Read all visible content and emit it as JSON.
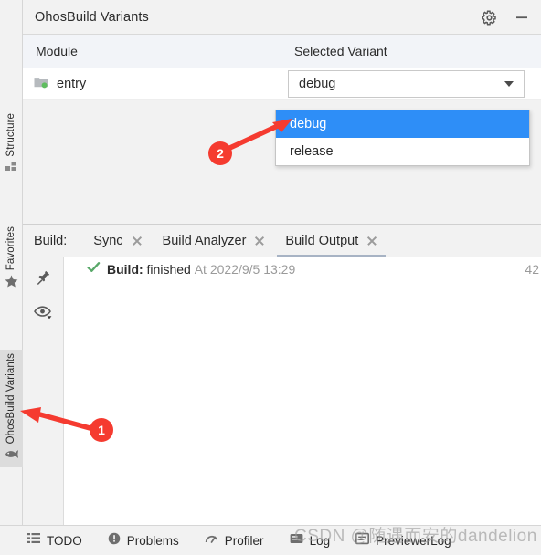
{
  "panel": {
    "title": "OhosBuild Variants",
    "actions": [
      {
        "name": "settings-icon",
        "label": "Settings"
      },
      {
        "name": "minimize-icon",
        "label": "Hide"
      }
    ],
    "columns": [
      "Module",
      "Selected Variant"
    ],
    "rows": [
      {
        "module": "entry",
        "variant": "debug"
      }
    ],
    "dropdown": {
      "open": true,
      "options": [
        "debug",
        "release"
      ],
      "selected": "debug"
    }
  },
  "left_rail": {
    "top_items": [
      {
        "label": "Structure",
        "icon": "structure-icon",
        "active": false
      },
      {
        "label": "Favorites",
        "icon": "star-icon",
        "active": false
      }
    ],
    "bottom_items": [
      {
        "label": "OhosBuild Variants",
        "icon": "fish-icon",
        "active": true
      }
    ]
  },
  "build_window": {
    "prefix": "Build:",
    "tabs": [
      {
        "label": "Sync",
        "active": false,
        "closable": true
      },
      {
        "label": "Build Analyzer",
        "active": false,
        "closable": true
      },
      {
        "label": "Build Output",
        "active": true,
        "closable": true
      }
    ],
    "gutter_buttons": [
      {
        "name": "pin-icon",
        "label": "Pin Tab"
      },
      {
        "name": "eye-icon",
        "label": "Show Options"
      }
    ],
    "output_row": {
      "status_icon": "check-icon",
      "prefix": "Build:",
      "result": "finished",
      "timestamp": "At 2022/9/5 13:29",
      "duration": "42"
    }
  },
  "status_bar": {
    "items": [
      {
        "label": "TODO",
        "icon": "list-icon"
      },
      {
        "label": "Problems",
        "icon": "warning-icon"
      },
      {
        "label": "Profiler",
        "icon": "gauge-icon"
      },
      {
        "label": "Log",
        "icon": "log-icon"
      },
      {
        "label": "PreviewerLog",
        "icon": "previewer-icon"
      }
    ]
  },
  "annotations": [
    {
      "number": "1"
    },
    {
      "number": "2"
    }
  ],
  "watermark": "CSDN @随遇而安的dandelion",
  "colors": {
    "accent": "#2e8ef7",
    "annotation": "#f53b30",
    "success": "#59a869"
  }
}
